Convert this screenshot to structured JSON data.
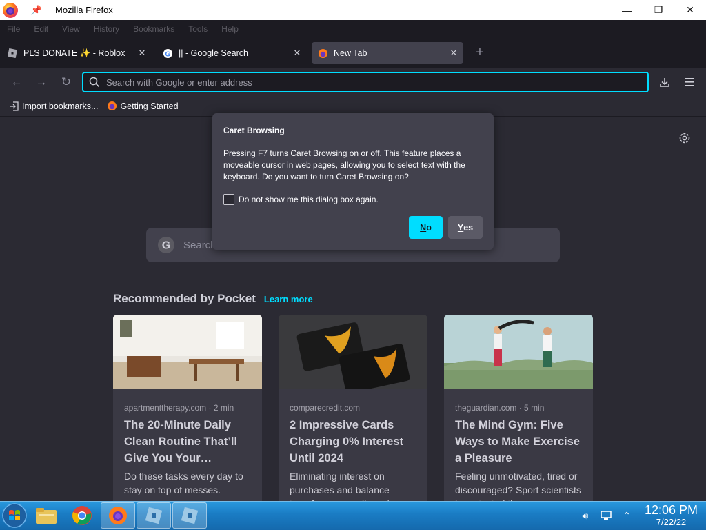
{
  "window": {
    "title": "Mozilla Firefox",
    "controls": [
      "minimize",
      "restore",
      "close"
    ]
  },
  "menubar": {
    "items": [
      "File",
      "Edit",
      "View",
      "History",
      "Bookmarks",
      "Tools",
      "Help"
    ]
  },
  "tabs": [
    {
      "label": "PLS DONATE ✨ - Roblox",
      "icon": "roblox-icon",
      "active": false
    },
    {
      "label": "|| - Google Search",
      "icon": "google-icon",
      "active": false
    },
    {
      "label": "New Tab",
      "icon": "firefox-icon",
      "active": true
    }
  ],
  "navbar": {
    "url_placeholder": "Search with Google or enter address"
  },
  "bookmarks": [
    {
      "label": "Import bookmarks...",
      "icon": "import-icon"
    },
    {
      "label": "Getting Started",
      "icon": "firefox-icon"
    }
  ],
  "newtab": {
    "search_placeholder": "Search"
  },
  "pocket": {
    "heading": "Recommended by Pocket",
    "learn_more": "Learn more",
    "cards": [
      {
        "source": "apartmenttherapy.com · 2 min",
        "title": "The 20-Minute Daily Clean Routine That’ll Give You Your…",
        "excerpt": "Do these tasks every day to stay on top of messes."
      },
      {
        "source": "comparecredit.com",
        "title": "2 Impressive Cards Charging 0% Interest Until 2024",
        "excerpt": "Eliminating interest on purchases and balance transfers can really make a"
      },
      {
        "source": "theguardian.com · 5 min",
        "title": "The Mind Gym: Five Ways to Make Exercise a Pleasure",
        "excerpt": "Feeling unmotivated, tired or discouraged? Sport scientists have tested the"
      }
    ]
  },
  "dialog": {
    "title": "Caret Browsing",
    "body": "Pressing F7 turns Caret Browsing on or off. This feature places a moveable cursor in web pages, allowing you to select text with the keyboard. Do you want to turn Caret Browsing on?",
    "checkbox_label": "Do not show me this dialog box again.",
    "no_button": {
      "accesskey": "N",
      "rest": "o"
    },
    "yes_button": {
      "accesskey": "Y",
      "rest": "es"
    }
  },
  "taskbar": {
    "time": "12:06 PM",
    "date": "7/22/22",
    "items": [
      "start-button",
      "file-explorer",
      "chrome",
      "firefox",
      "roblox-app-1",
      "roblox-app-2"
    ]
  },
  "colors": {
    "accent": "#00ddff",
    "chrome_bg": "#1c1b22",
    "content_bg": "#2b2a33",
    "dialog_bg": "#42414d"
  }
}
